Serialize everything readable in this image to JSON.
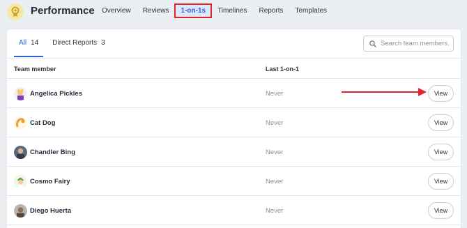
{
  "header": {
    "title": "Performance",
    "nav": [
      {
        "label": "Overview",
        "active": false
      },
      {
        "label": "Reviews",
        "active": false
      },
      {
        "label": "1-on-1s",
        "active": true
      },
      {
        "label": "Timelines",
        "active": false
      },
      {
        "label": "Reports",
        "active": false
      },
      {
        "label": "Templates",
        "active": false
      }
    ]
  },
  "filters": {
    "tabs": [
      {
        "label": "All",
        "count": "14",
        "active": true
      },
      {
        "label": "Direct Reports",
        "count": "3",
        "active": false
      }
    ],
    "search_placeholder": "Search team members..."
  },
  "table": {
    "columns": {
      "member": "Team member",
      "last": "Last 1-on-1"
    },
    "rows": [
      {
        "name": "Angelica Pickles",
        "last": "Never",
        "action": "View"
      },
      {
        "name": "Cat Dog",
        "last": "Never",
        "action": "View"
      },
      {
        "name": "Chandler Bing",
        "last": "Never",
        "action": "View"
      },
      {
        "name": "Cosmo Fairy",
        "last": "Never",
        "action": "View"
      },
      {
        "name": "Diego Huerta",
        "last": "Never",
        "action": "View"
      }
    ]
  },
  "colors": {
    "accent": "#2f5fd0",
    "annotation": "#e0242a"
  }
}
